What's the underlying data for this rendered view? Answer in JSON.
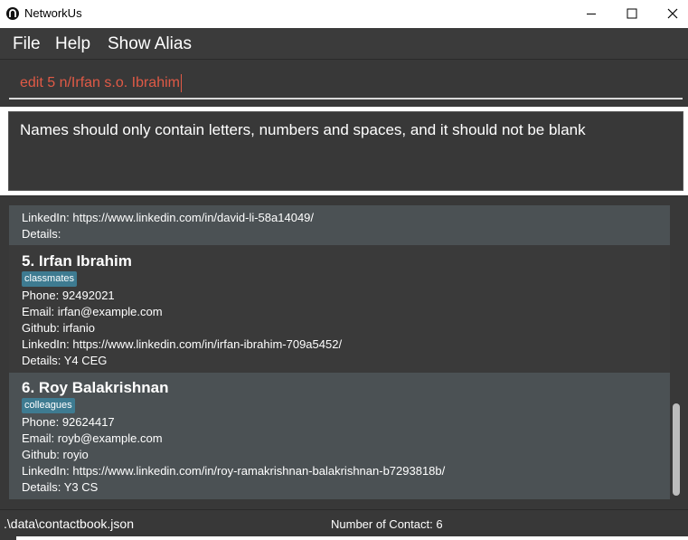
{
  "window": {
    "title": "NetworkUs",
    "controls": [
      "minimize-icon",
      "maximize-icon",
      "close-icon"
    ]
  },
  "menu": {
    "file": "File",
    "help": "Help",
    "show_alias": "Show Alias"
  },
  "command_box": {
    "value": "edit 5 n/Irfan s.o. Ibrahim",
    "text_color": "#e05a46"
  },
  "result_display": {
    "message": "Names should only contain letters, numbers and spaces, and it should not be blank"
  },
  "persons": {
    "partial": {
      "linkedin": "LinkedIn: https://www.linkedin.com/in/david-li-58a14049/",
      "details": "Details:"
    },
    "p5": {
      "header": "5.  Irfan Ibrahim",
      "tag": "classmates",
      "phone": "Phone: 92492021",
      "email": "Email: irfan@example.com",
      "github": "Github: irfanio",
      "linkedin": "LinkedIn: https://www.linkedin.com/in/irfan-ibrahim-709a5452/",
      "details": "Details: Y4 CEG"
    },
    "p6": {
      "header": "6.  Roy Balakrishnan",
      "tag": "colleagues",
      "phone": "Phone: 92624417",
      "email": "Email: royb@example.com",
      "github": "Github: royio",
      "linkedin": "LinkedIn: https://www.linkedin.com/in/roy-ramakrishnan-balakrishnan-b7293818b/",
      "details": "Details: Y3 CS"
    }
  },
  "status_bar": {
    "path": ".\\data\\contactbook.json",
    "count": "Number of Contact: 6"
  },
  "colors": {
    "tag_bg": "#3e7b91",
    "card_even": "#4b5154",
    "card_odd": "#3a3a3a",
    "panel": "#383838"
  }
}
